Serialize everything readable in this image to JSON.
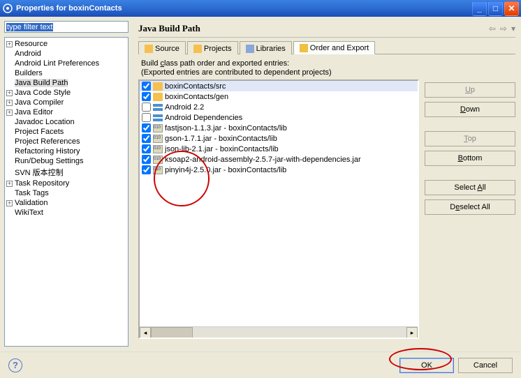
{
  "window": {
    "title": "Properties for boxinContacts"
  },
  "filter": {
    "value": "type filter text"
  },
  "tree": {
    "items": [
      {
        "label": "Resource",
        "expand": "+",
        "depth": 0
      },
      {
        "label": "Android",
        "expand": "",
        "depth": 0
      },
      {
        "label": "Android Lint Preferences",
        "expand": "",
        "depth": 0
      },
      {
        "label": "Builders",
        "expand": "",
        "depth": 0
      },
      {
        "label": "Java Build Path",
        "expand": "",
        "depth": 0,
        "selected": true
      },
      {
        "label": "Java Code Style",
        "expand": "+",
        "depth": 0
      },
      {
        "label": "Java Compiler",
        "expand": "+",
        "depth": 0
      },
      {
        "label": "Java Editor",
        "expand": "+",
        "depth": 0
      },
      {
        "label": "Javadoc Location",
        "expand": "",
        "depth": 0
      },
      {
        "label": "Project Facets",
        "expand": "",
        "depth": 0
      },
      {
        "label": "Project References",
        "expand": "",
        "depth": 0
      },
      {
        "label": "Refactoring History",
        "expand": "",
        "depth": 0
      },
      {
        "label": "Run/Debug Settings",
        "expand": "",
        "depth": 0
      },
      {
        "label": "SVN 版本控制",
        "expand": "",
        "depth": 0
      },
      {
        "label": "Task Repository",
        "expand": "+",
        "depth": 0
      },
      {
        "label": "Task Tags",
        "expand": "",
        "depth": 0
      },
      {
        "label": "Validation",
        "expand": "+",
        "depth": 0
      },
      {
        "label": "WikiText",
        "expand": "",
        "depth": 0
      }
    ]
  },
  "page": {
    "title": "Java Build Path",
    "tabs": [
      {
        "label": "Source",
        "icon": "source"
      },
      {
        "label": "Projects",
        "icon": "projects"
      },
      {
        "label": "Libraries",
        "icon": "libraries"
      },
      {
        "label": "Order and Export",
        "icon": "order",
        "active": true
      }
    ],
    "desc_line1_pre": "Build ",
    "desc_line1_u": "c",
    "desc_line1_post": "lass path order and exported entries:",
    "desc_line2": "(Exported entries are contributed to dependent projects)",
    "entries": [
      {
        "checked": true,
        "icon": "folder",
        "label": "boxinContacts/src",
        "selected": true
      },
      {
        "checked": true,
        "icon": "folder",
        "label": "boxinContacts/gen"
      },
      {
        "checked": false,
        "icon": "lib",
        "label": "Android 2.2"
      },
      {
        "checked": false,
        "icon": "lib",
        "label": "Android Dependencies"
      },
      {
        "checked": true,
        "icon": "jar",
        "label": "fastjson-1.1.3.jar - boxinContacts/lib"
      },
      {
        "checked": true,
        "icon": "jar",
        "label": "gson-1.7.1.jar - boxinContacts/lib"
      },
      {
        "checked": true,
        "icon": "jar",
        "label": "json-lib-2.1.jar - boxinContacts/lib"
      },
      {
        "checked": true,
        "icon": "jar",
        "label": "ksoap2-android-assembly-2.5.7-jar-with-dependencies.jar"
      },
      {
        "checked": true,
        "icon": "jar",
        "label": "pinyin4j-2.5.0.jar - boxinContacts/lib"
      }
    ],
    "buttons": {
      "up": "Up",
      "down": "Down",
      "top": "Top",
      "bottom": "Bottom",
      "select_all_pre": "Select ",
      "select_all_u": "A",
      "select_all_post": "ll",
      "deselect_all_pre": "D",
      "deselect_all_u": "e",
      "deselect_all_post": "select All"
    }
  },
  "footer": {
    "ok": "OK",
    "cancel": "Cancel"
  }
}
